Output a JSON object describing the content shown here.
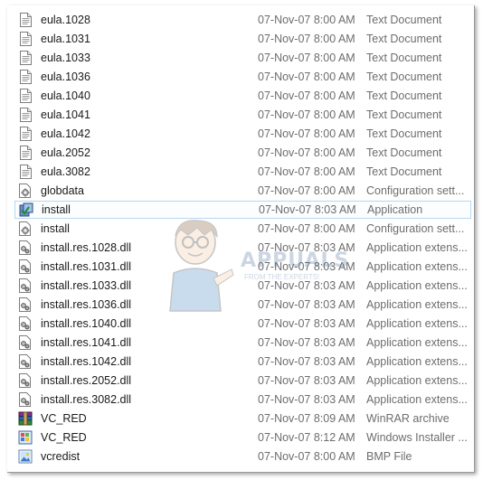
{
  "files": [
    {
      "name": "eula.1028",
      "date": "07-Nov-07 8:00 AM",
      "type": "Text Document",
      "icon": "text-file-icon"
    },
    {
      "name": "eula.1031",
      "date": "07-Nov-07 8:00 AM",
      "type": "Text Document",
      "icon": "text-file-icon"
    },
    {
      "name": "eula.1033",
      "date": "07-Nov-07 8:00 AM",
      "type": "Text Document",
      "icon": "text-file-icon"
    },
    {
      "name": "eula.1036",
      "date": "07-Nov-07 8:00 AM",
      "type": "Text Document",
      "icon": "text-file-icon"
    },
    {
      "name": "eula.1040",
      "date": "07-Nov-07 8:00 AM",
      "type": "Text Document",
      "icon": "text-file-icon"
    },
    {
      "name": "eula.1041",
      "date": "07-Nov-07 8:00 AM",
      "type": "Text Document",
      "icon": "text-file-icon"
    },
    {
      "name": "eula.1042",
      "date": "07-Nov-07 8:00 AM",
      "type": "Text Document",
      "icon": "text-file-icon"
    },
    {
      "name": "eula.2052",
      "date": "07-Nov-07 8:00 AM",
      "type": "Text Document",
      "icon": "text-file-icon"
    },
    {
      "name": "eula.3082",
      "date": "07-Nov-07 8:00 AM",
      "type": "Text Document",
      "icon": "text-file-icon"
    },
    {
      "name": "globdata",
      "date": "07-Nov-07 8:00 AM",
      "type": "Configuration sett...",
      "icon": "config-file-icon"
    },
    {
      "name": "install",
      "date": "07-Nov-07 8:03 AM",
      "type": "Application",
      "icon": "installer-app-icon",
      "selected": true
    },
    {
      "name": "install",
      "date": "07-Nov-07 8:00 AM",
      "type": "Configuration sett...",
      "icon": "config-file-icon"
    },
    {
      "name": "install.res.1028.dll",
      "date": "07-Nov-07 8:03 AM",
      "type": "Application extens...",
      "icon": "dll-file-icon"
    },
    {
      "name": "install.res.1031.dll",
      "date": "07-Nov-07 8:03 AM",
      "type": "Application extens...",
      "icon": "dll-file-icon"
    },
    {
      "name": "install.res.1033.dll",
      "date": "07-Nov-07 8:03 AM",
      "type": "Application extens...",
      "icon": "dll-file-icon"
    },
    {
      "name": "install.res.1036.dll",
      "date": "07-Nov-07 8:03 AM",
      "type": "Application extens...",
      "icon": "dll-file-icon"
    },
    {
      "name": "install.res.1040.dll",
      "date": "07-Nov-07 8:03 AM",
      "type": "Application extens...",
      "icon": "dll-file-icon"
    },
    {
      "name": "install.res.1041.dll",
      "date": "07-Nov-07 8:03 AM",
      "type": "Application extens...",
      "icon": "dll-file-icon"
    },
    {
      "name": "install.res.1042.dll",
      "date": "07-Nov-07 8:03 AM",
      "type": "Application extens...",
      "icon": "dll-file-icon"
    },
    {
      "name": "install.res.2052.dll",
      "date": "07-Nov-07 8:03 AM",
      "type": "Application extens...",
      "icon": "dll-file-icon"
    },
    {
      "name": "install.res.3082.dll",
      "date": "07-Nov-07 8:03 AM",
      "type": "Application extens...",
      "icon": "dll-file-icon"
    },
    {
      "name": "VC_RED",
      "date": "07-Nov-07 8:09 AM",
      "type": "WinRAR archive",
      "icon": "winrar-archive-icon"
    },
    {
      "name": "VC_RED",
      "date": "07-Nov-07 8:12 AM",
      "type": "Windows Installer ...",
      "icon": "msi-installer-icon"
    },
    {
      "name": "vcredist",
      "date": "07-Nov-07 8:00 AM",
      "type": "BMP File",
      "icon": "bmp-image-icon"
    }
  ],
  "watermark": {
    "text": "APPUALS",
    "subtext": "FROM THE EXPERTS!"
  },
  "colors": {
    "selection_border": "#b9d7ef",
    "secondary_text": "#6d6d6d"
  }
}
